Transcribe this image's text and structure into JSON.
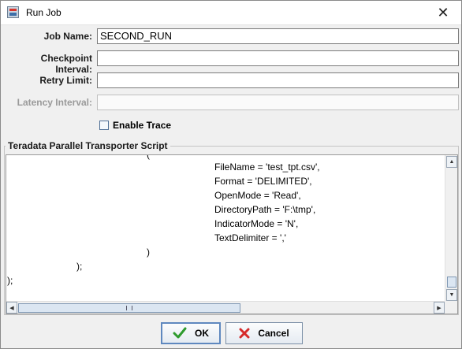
{
  "window": {
    "title": "Run Job",
    "close_glyph": "✕"
  },
  "form": {
    "job_name": {
      "label": "Job Name:",
      "value": "SECOND_RUN"
    },
    "checkpoint_interval": {
      "label": "Checkpoint Interval:",
      "value": ""
    },
    "retry_limit": {
      "label": "Retry Limit:",
      "value": ""
    },
    "latency_interval": {
      "label": "Latency Interval:",
      "value": "",
      "disabled": true
    }
  },
  "enable_trace": {
    "label": "Enable Trace",
    "checked": false
  },
  "script": {
    "group_title": "Teradata Parallel Transporter Script",
    "lines": [
      "(",
      "FileName = 'test_tpt.csv',",
      "Format = 'DELIMITED',",
      "OpenMode = 'Read',",
      "DirectoryPath = 'F:\\tmp',",
      "IndicatorMode = 'N',",
      "TextDelimiter = ','",
      ")",
      ");",
      ");"
    ]
  },
  "buttons": {
    "ok": "OK",
    "cancel": "Cancel"
  },
  "colors": {
    "ok_icon": "#2e9b2e",
    "cancel_icon": "#d62b2b"
  }
}
